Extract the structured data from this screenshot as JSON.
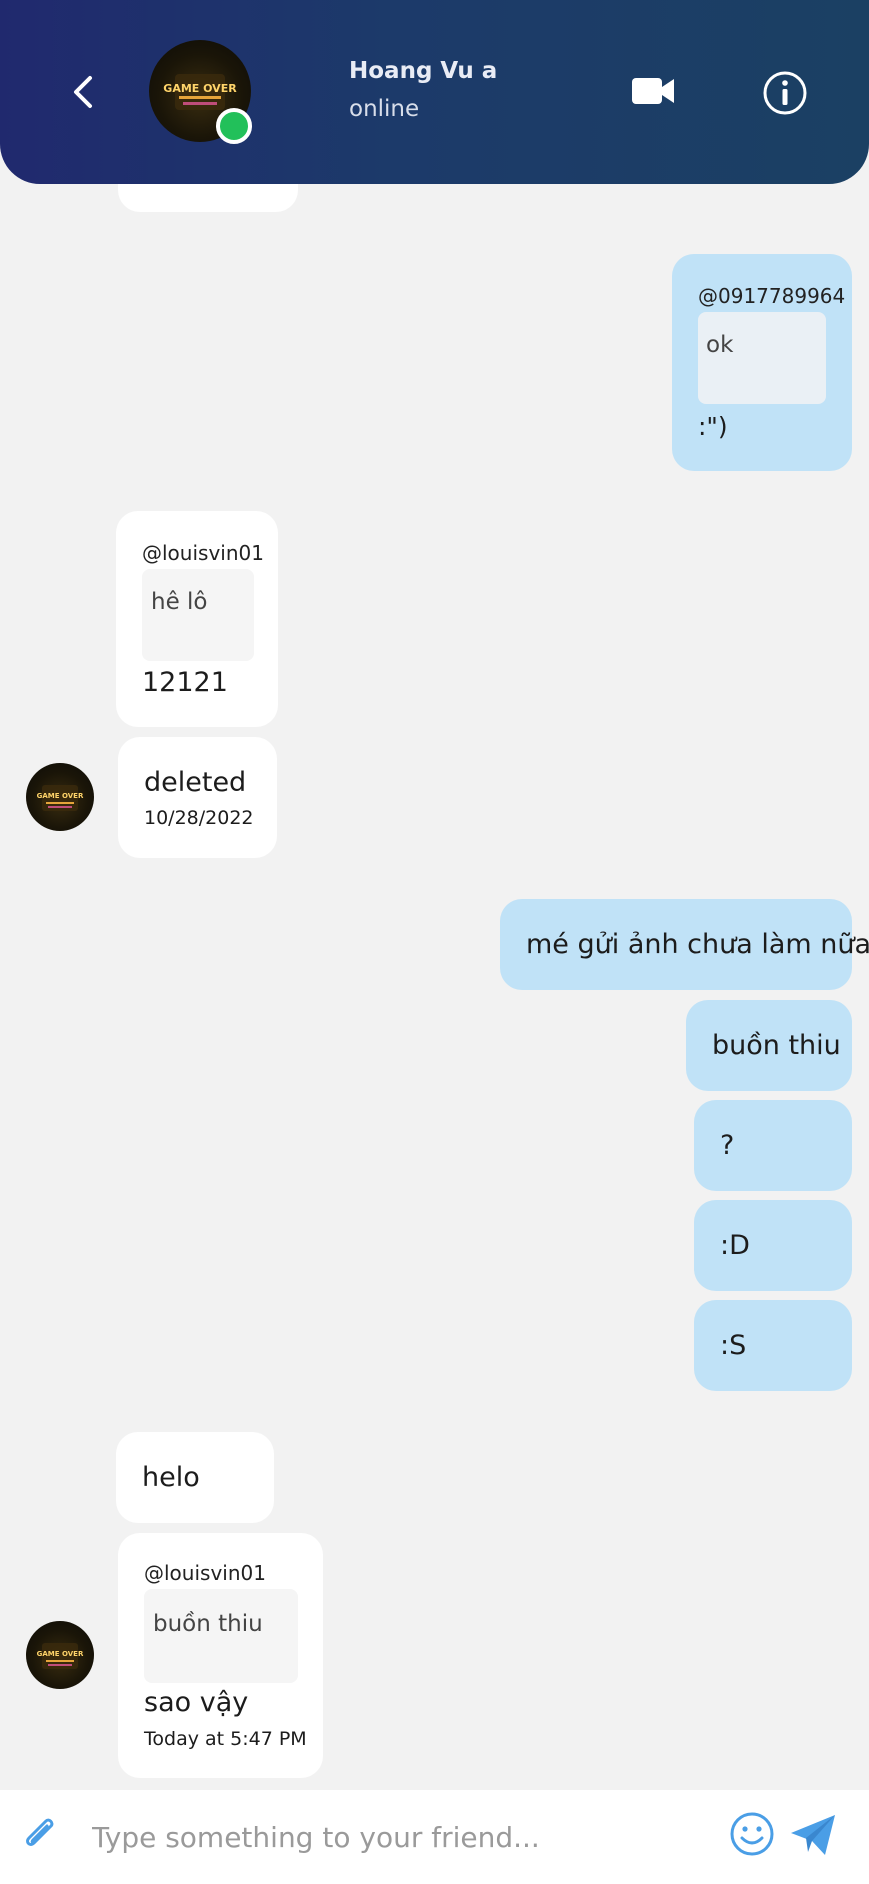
{
  "header": {
    "contact_name": "Hoang Vu a",
    "status": "online",
    "avatar_text": "GAME OVER"
  },
  "messages": {
    "m0": {
      "sender": "friend"
    },
    "m1": {
      "sender": "me",
      "mention": "@0917789964",
      "quote": "ok",
      "text": ":\")"
    },
    "m2": {
      "sender": "friend",
      "mention": "@louisvin01",
      "quote": "hê lô",
      "text": "12121"
    },
    "m3": {
      "sender": "friend",
      "text": "deleted",
      "time": "10/28/2022"
    },
    "m4": {
      "sender": "me",
      "text": "mé gửi ảnh chưa làm nữa"
    },
    "m5": {
      "sender": "me",
      "text": "buồn thiu"
    },
    "m6": {
      "sender": "me",
      "text": "?"
    },
    "m7": {
      "sender": "me",
      "text": ":D"
    },
    "m8": {
      "sender": "me",
      "text": ":S"
    },
    "m9": {
      "sender": "friend",
      "text": "helo"
    },
    "m10": {
      "sender": "friend",
      "mention": "@louisvin01",
      "quote": "buồn thiu",
      "text": "sao vậy",
      "time": "Today at 5:47 PM"
    }
  },
  "composer": {
    "placeholder": "Type something to your friend...",
    "value": ""
  },
  "icons": {
    "back": "chevron-left-icon",
    "video": "video-camera-icon",
    "info": "info-icon",
    "attach": "paperclip-icon",
    "emoji": "smiley-icon",
    "send": "send-icon"
  },
  "colors": {
    "header_gradient_start": "#20296e",
    "header_gradient_end": "#1b4063",
    "my_bubble": "#c0e2f7",
    "friend_bubble": "#ffffff",
    "online": "#22c05a",
    "accent_icon": "#4a9ee6",
    "background": "#f2f2f2"
  }
}
